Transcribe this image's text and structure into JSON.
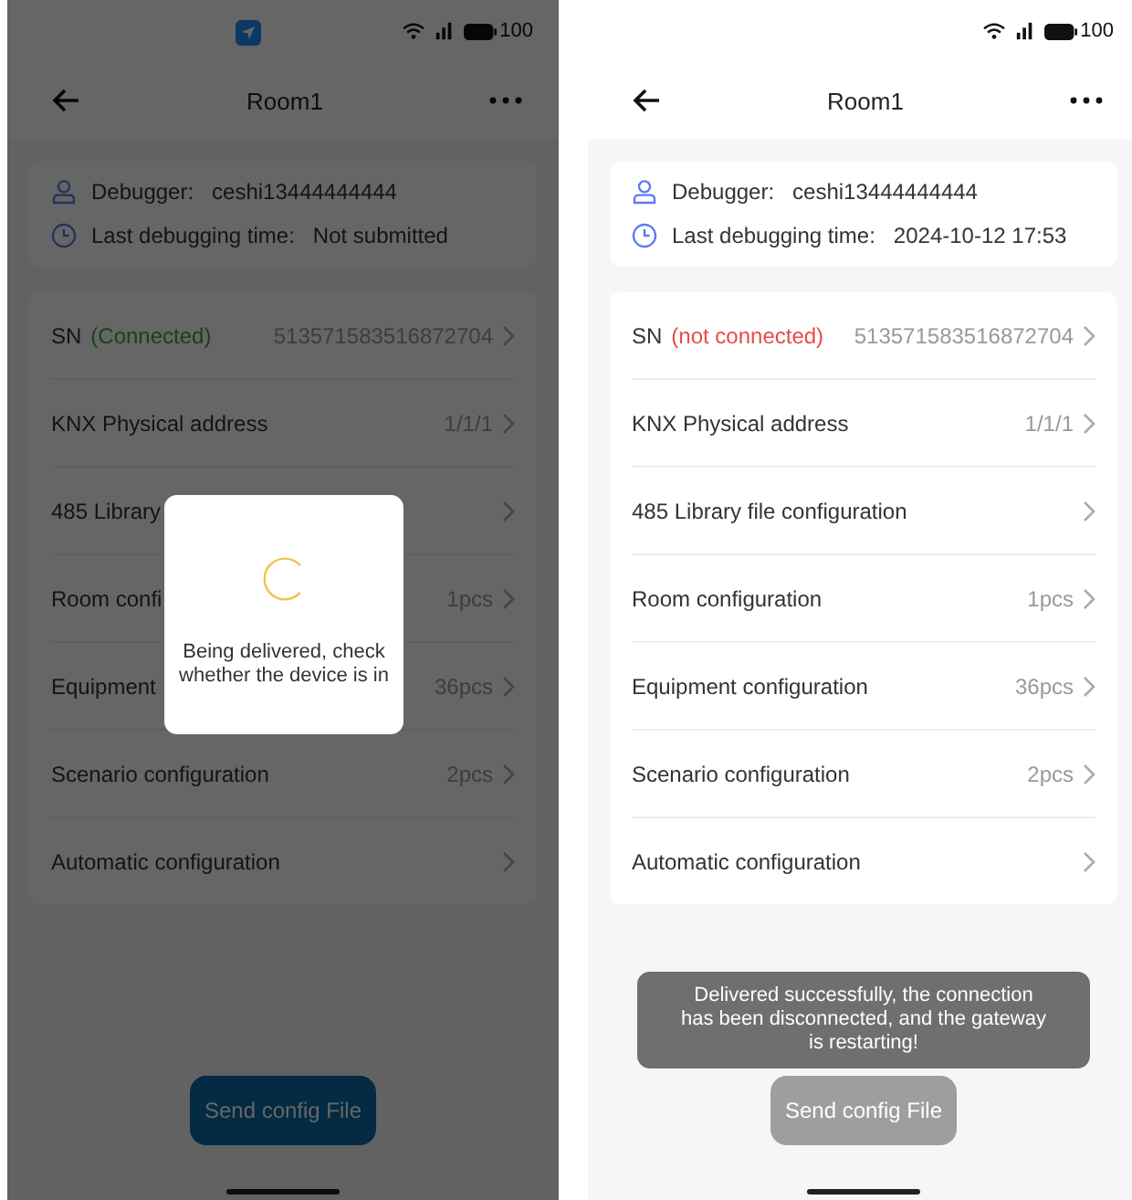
{
  "screens": [
    {
      "status_bar": {
        "location_on": true,
        "battery": "100"
      },
      "title": "Room1",
      "dimmed": true,
      "info": [
        {
          "kind": "user",
          "label": "Debugger:",
          "value": "ceshi13444444444"
        },
        {
          "kind": "clock",
          "label": "Last debugging time:",
          "value": "Not submitted"
        }
      ],
      "rows": [
        {
          "label": "SN",
          "status": {
            "text": "(Connected)",
            "connected": true
          },
          "value": "513571583516872704"
        },
        {
          "label": "KNX Physical address",
          "value": "1/1/1"
        },
        {
          "label": "485 Library"
        },
        {
          "label": "Room confi",
          "value": "1pcs"
        },
        {
          "label": "Equipment",
          "value": "36pcs"
        },
        {
          "label": "Scenario configuration",
          "value": "2pcs"
        },
        {
          "label": "Automatic configuration"
        }
      ],
      "dialog": {
        "message": "Being delivered, check whether the device is in"
      },
      "send_button": {
        "label": "Send config File",
        "disabled": false
      }
    },
    {
      "status_bar": {
        "location_on": false,
        "battery": "100"
      },
      "title": "Room1",
      "dimmed": false,
      "info": [
        {
          "kind": "user",
          "label": "Debugger:",
          "value": "ceshi13444444444"
        },
        {
          "kind": "clock",
          "label": "Last debugging time:",
          "value": "2024-10-12 17:53"
        }
      ],
      "rows": [
        {
          "label": "SN",
          "status": {
            "text": "(not connected)",
            "connected": false
          },
          "value": "513571583516872704"
        },
        {
          "label": "KNX Physical address",
          "value": "1/1/1"
        },
        {
          "label": "485 Library file configuration"
        },
        {
          "label": "Room configuration",
          "value": "1pcs"
        },
        {
          "label": "Equipment configuration",
          "value": "36pcs"
        },
        {
          "label": "Scenario configuration",
          "value": "2pcs"
        },
        {
          "label": "Automatic configuration"
        }
      ],
      "toast": {
        "message": "Delivered successfully, the connection has been disconnected, and the gateway is restarting!"
      },
      "send_button": {
        "label": "Send config File",
        "disabled": true
      }
    }
  ]
}
